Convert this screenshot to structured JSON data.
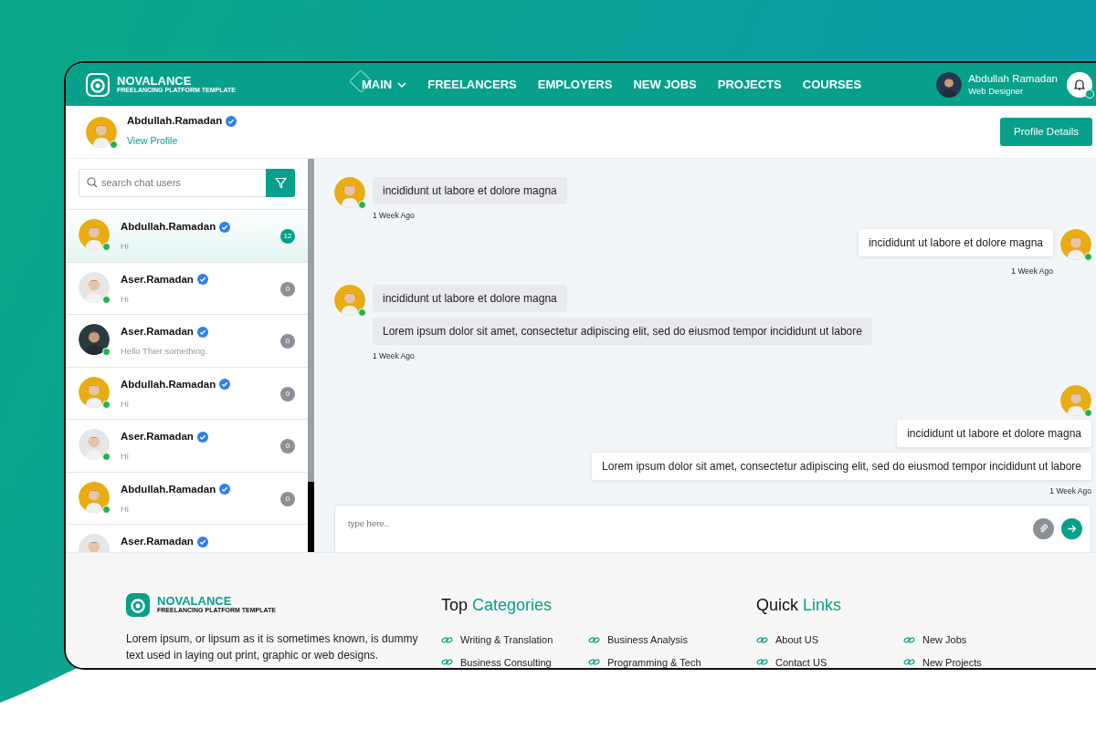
{
  "navbar": {
    "logo": {
      "name": "NOVALANCE",
      "tagline": "FREELANCING PLATFORM TEMPLATE"
    },
    "menu": [
      {
        "label": "MAIN",
        "selected": true,
        "dropdown": true
      },
      {
        "label": "FREELANCERS",
        "selected": false,
        "dropdown": false
      },
      {
        "label": "EMPLOYERS",
        "selected": false,
        "dropdown": false
      },
      {
        "label": "NEW JOBS",
        "selected": false,
        "dropdown": false
      },
      {
        "label": "PROJECTS",
        "selected": false,
        "dropdown": false
      },
      {
        "label": "COURSES",
        "selected": false,
        "dropdown": false
      }
    ],
    "user": {
      "name": "Abdullah Ramadan",
      "role": "Web Designer"
    },
    "notifications": {
      "unread": true
    }
  },
  "profile": {
    "name": "Abdullah.Ramadan",
    "verified": true,
    "online": true,
    "link": "View Profile",
    "button": "Profile Details"
  },
  "chat_list": {
    "search": {
      "placeholder": "search chat users"
    },
    "items": [
      {
        "name": "Abdullah.Ramadan",
        "verified": true,
        "online": true,
        "message": "Hi",
        "count": "12",
        "selected": true
      },
      {
        "name": "Aser.Ramadan",
        "verified": true,
        "online": true,
        "message": "Hi",
        "count": "0",
        "selected": false
      },
      {
        "name": "Aser.Ramadan",
        "verified": true,
        "online": true,
        "message": "Hello Thier something.",
        "count": "0",
        "selected": false
      },
      {
        "name": "Abdullah.Ramadan",
        "verified": true,
        "online": true,
        "message": "Hi",
        "count": "0",
        "selected": false
      },
      {
        "name": "Aser.Ramadan",
        "verified": true,
        "online": true,
        "message": "Hi",
        "count": "0",
        "selected": false
      },
      {
        "name": "Abdullah.Ramadan",
        "verified": true,
        "online": true,
        "message": "Hi",
        "count": "0",
        "selected": false
      },
      {
        "name": "Aser.Ramadan",
        "verified": true,
        "selected": false
      }
    ]
  },
  "conversation": {
    "groups": [
      {
        "kind": "incoming",
        "online": true,
        "messages": [
          "incididunt ut labore et dolore magna"
        ],
        "time": "1 Week Ago"
      },
      {
        "kind": "outgoing",
        "online": true,
        "messages": [
          "incididunt ut labore et dolore magna"
        ],
        "time": "1 Week Ago"
      },
      {
        "kind": "incoming",
        "online": true,
        "messages": [
          "incididunt ut labore et dolore magna",
          "Lorem ipsum dolor sit amet, consectetur adipiscing elit, sed do eiusmod tempor incididunt ut labore"
        ],
        "time": "1 Week Ago"
      },
      {
        "kind": "outgoing",
        "online": true,
        "messages": [
          "incididunt ut labore et dolore magna",
          "Lorem ipsum dolor sit amet, consectetur adipiscing elit, sed do eiusmod tempor incididunt ut labore"
        ],
        "time": "1 Week Ago"
      }
    ],
    "composer": {
      "placeholder": "type here.."
    }
  },
  "footer": {
    "logo": {
      "name": "NOVALANCE",
      "tagline": "FREELANCING PLATFORM TEMPLATE"
    },
    "description": "Lorem ipsum, or lipsum as it is sometimes known, is dummy text used in laying out print, graphic or web designs.",
    "sections": [
      {
        "title": "Top",
        "title_accent": "Categories",
        "links": [
          "Writing & Translation",
          "Business Analysis",
          "Business Consulting",
          "Programming & Tech"
        ]
      },
      {
        "title": "Quick",
        "title_accent": "Links",
        "links": [
          "About US",
          "New Jobs",
          "Contact US",
          "New Projects"
        ]
      }
    ]
  }
}
